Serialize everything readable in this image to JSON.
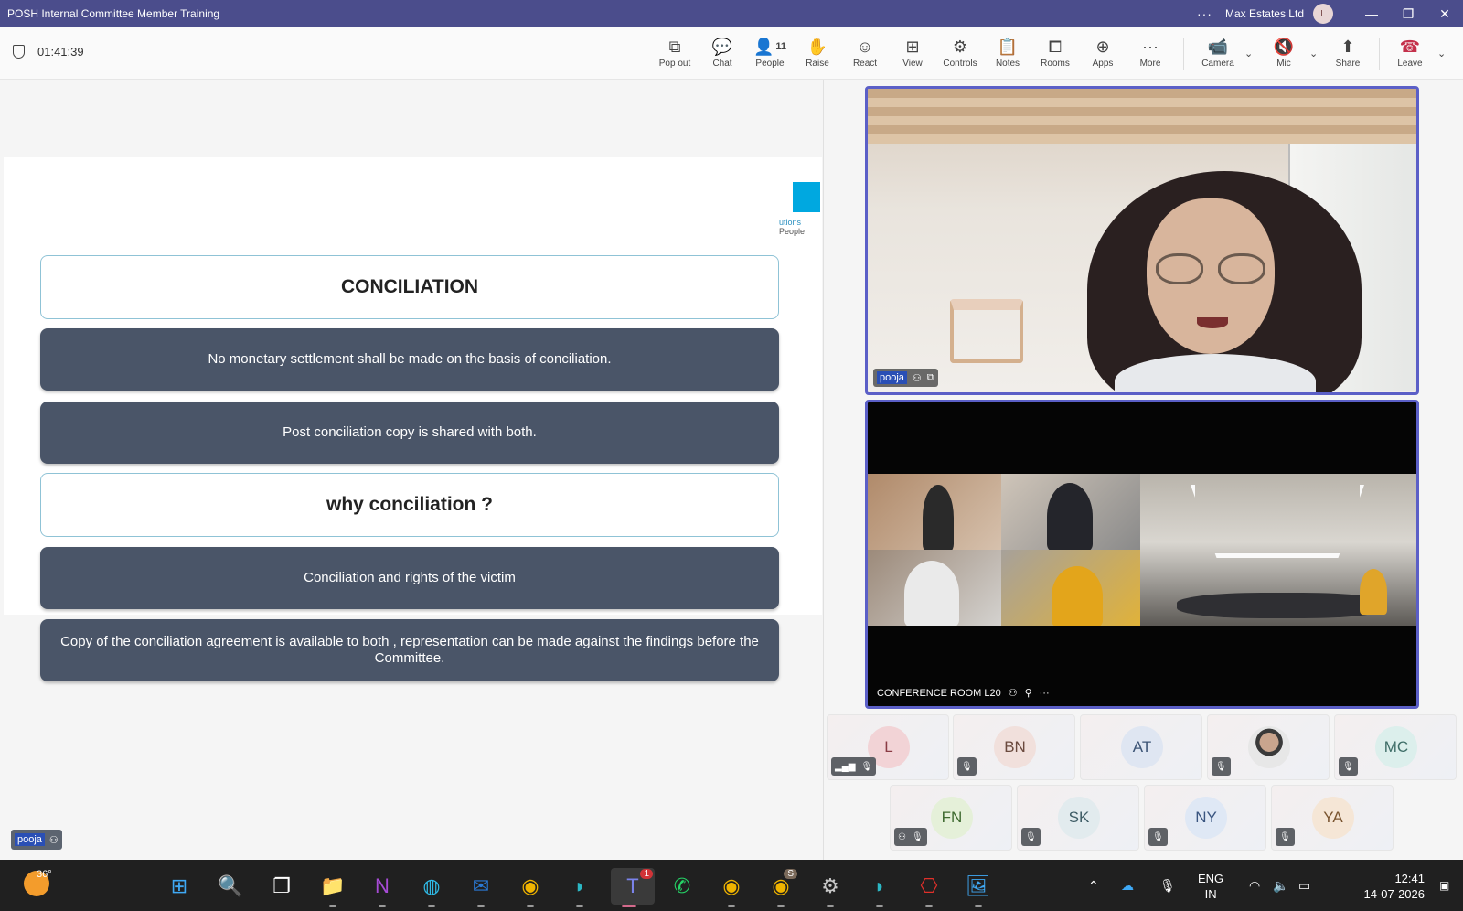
{
  "window": {
    "title": "POSH Internal Committee Member Training",
    "org": "Max Estates Ltd",
    "user_initial": "L",
    "more": "···",
    "minimize": "—",
    "restore": "❐",
    "close": "✕"
  },
  "meeting": {
    "timer": "01:41:39",
    "people_count": "11"
  },
  "toolbar": {
    "items": [
      {
        "label": "Pop out",
        "icon": "pop-out-icon",
        "glyph": "⧉"
      },
      {
        "label": "Chat",
        "icon": "chat-icon",
        "glyph": "💬"
      },
      {
        "label": "People",
        "icon": "people-icon",
        "glyph": "👤"
      },
      {
        "label": "Raise",
        "icon": "hand-icon",
        "glyph": "✋"
      },
      {
        "label": "React",
        "icon": "smiley-icon",
        "glyph": "☺"
      },
      {
        "label": "View",
        "icon": "grid-icon",
        "glyph": "⊞"
      },
      {
        "label": "Controls",
        "icon": "controls-icon",
        "glyph": "⚙"
      },
      {
        "label": "Notes",
        "icon": "notes-icon",
        "glyph": "📋"
      },
      {
        "label": "Rooms",
        "icon": "rooms-icon",
        "glyph": "⧠"
      },
      {
        "label": "Apps",
        "icon": "apps-icon",
        "glyph": "⊕"
      },
      {
        "label": "More",
        "icon": "more-icon",
        "glyph": "···"
      }
    ],
    "camera": {
      "label": "Camera",
      "icon": "camera-off-icon",
      "glyph": "📹"
    },
    "mic": {
      "label": "Mic",
      "icon": "mic-off-icon",
      "glyph": "🔇"
    },
    "share": {
      "label": "Share",
      "icon": "share-icon",
      "glyph": "⬆"
    },
    "leave": {
      "label": "Leave",
      "icon": "phone-hangup-icon",
      "glyph": "☎"
    },
    "caret": "⌄"
  },
  "slide": {
    "heading1": "CONCILIATION",
    "point1": "No monetary settlement shall be made on the basis of conciliation.",
    "point2": "Post conciliation copy is shared with both.",
    "heading2": "why conciliation ?",
    "point3": "Conciliation and rights of the victim",
    "point4": "Copy of the conciliation agreement  is available to both , representation can be made against the findings before the Committee.",
    "logo_text_1": "utions",
    "logo_text_2": "People"
  },
  "presenter": {
    "name": "pooja"
  },
  "videos": {
    "top_name": "pooja",
    "bottom_name": "CONFERENCE ROOM L20",
    "bottom_more": "···"
  },
  "participants": [
    {
      "initials": "L",
      "bg": "#f2d3d6",
      "fg": "#8a3b44"
    },
    {
      "initials": "BN",
      "bg": "#f1e0dc",
      "fg": "#6b4a3e"
    },
    {
      "initials": "AT",
      "bg": "#dfe6f2",
      "fg": "#3c5475"
    },
    {
      "initials": "",
      "bg": "#d9d9d9",
      "fg": "#333333"
    },
    {
      "initials": "MC",
      "bg": "#dcefec",
      "fg": "#3f6e68"
    },
    {
      "initials": "FN",
      "bg": "#e5f0d9",
      "fg": "#3f6a30"
    },
    {
      "initials": "SK",
      "bg": "#e2ebee",
      "fg": "#3f5d66"
    },
    {
      "initials": "NY",
      "bg": "#dfe8f5",
      "fg": "#3a5580"
    },
    {
      "initials": "YA",
      "bg": "#f5e6d6",
      "fg": "#7a5530"
    }
  ],
  "taskbar": {
    "temperature": "36°",
    "teams_badge": "1",
    "chrome_badge": "S",
    "lang_line1": "ENG",
    "lang_line2": "IN",
    "time": "12:41",
    "date": "14-07-2026"
  },
  "colors": {
    "accent": "#5b5fc7",
    "titlebar": "#4b4d8c",
    "slide_box": "#4a5568",
    "slide_border": "#8fc3d6",
    "logo_blue": "#00a8e0"
  }
}
